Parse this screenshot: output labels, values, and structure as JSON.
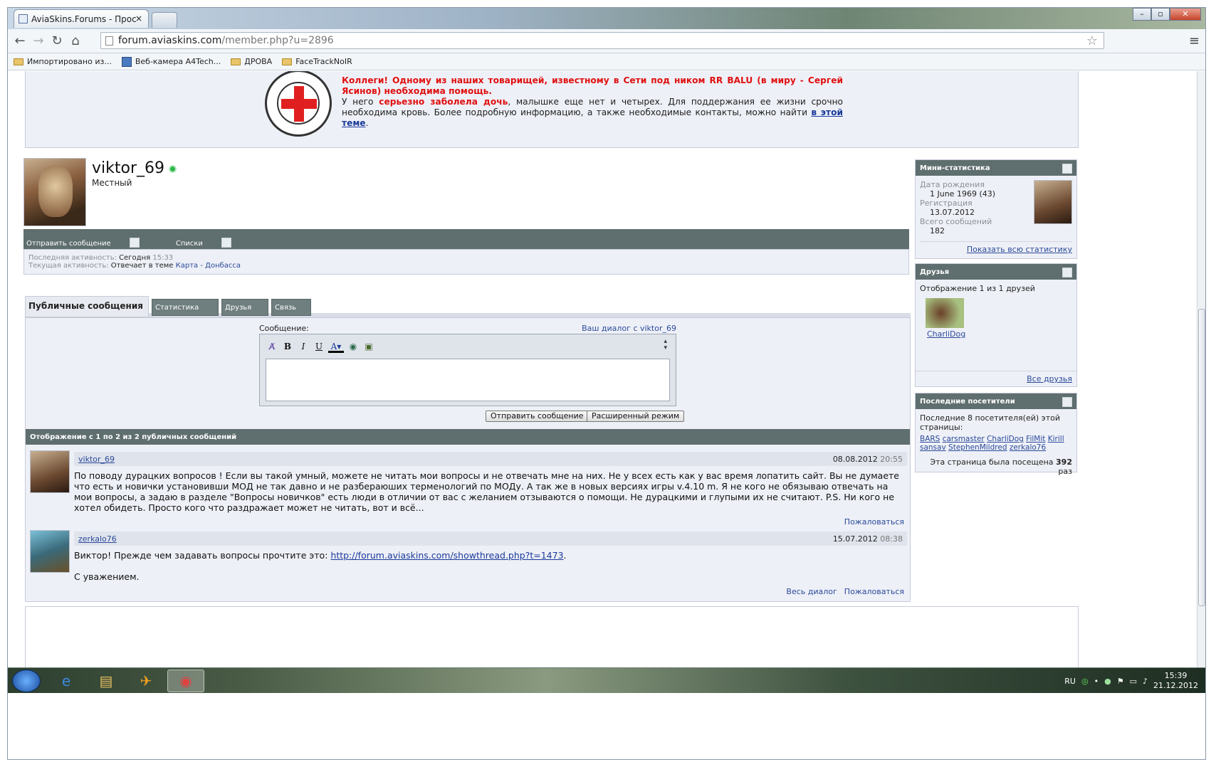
{
  "browser": {
    "tab_title": "AviaSkins.Forums - Прос",
    "tab_close": "×",
    "url_domain": "forum.aviaskins.com",
    "url_path": "/member.php?u=2896",
    "window_controls": {
      "minimize": "–",
      "maximize": "▫",
      "close": "✕"
    }
  },
  "bookmarks": [
    {
      "label": "Импортировано из...",
      "icon": "folder-icon"
    },
    {
      "label": "Веб-камера A4Tech...",
      "icon": "webcam-icon"
    },
    {
      "label": "ДРОВА",
      "icon": "folder-icon"
    },
    {
      "label": "FaceTrackNoIR",
      "icon": "folder-icon"
    }
  ],
  "notice": {
    "headline": "Коллеги! Одному из наших товарищей, известному в Сети под ником RR BALU (в миру - Сергей Ясинов) необходима помощь.",
    "line2_a": "У него ",
    "line2_red": "серьезно заболела дочь",
    "line2_b": ", малышке еще нет и четырех. Для поддержания ее жизни срочно необходима кровь. Более подробную информацию, а также необходимые контакты, можно найти ",
    "link": "в этой теме",
    "tail": "."
  },
  "profile": {
    "username": "viktor_69",
    "usertitle": "Местный",
    "actions": [
      "Отправить сообщение",
      "Списки"
    ],
    "last_activity_label": "Последняя активность:",
    "last_activity_day": "Сегодня",
    "last_activity_time": "15:33",
    "current_activity_label": "Текущая активность:",
    "current_activity_text": "Отвечает в теме",
    "current_activity_link": "Карта - Донбасса"
  },
  "tabs": [
    "Публичные сообщения",
    "Статистика",
    "Друзья",
    "Связь"
  ],
  "composer": {
    "label": "Сообщение:",
    "dialog_link": "Ваш диалог с viktor_69",
    "send_button": "Отправить сообщение",
    "advanced_button": "Расширенный режим"
  },
  "messages": {
    "header": "Отображение с 1 по 2 из 2 публичных сообщений",
    "posts": [
      {
        "author": "viktor_69",
        "date": "08.08.2012",
        "time": "20:55",
        "text": "По поводу дурацких вопросов ! Если вы такой умный, можете не читать мои вопросы и не отвечать мне на них. Не у всех есть как у вас время лопатить сайт. Вы не думаете что есть и новички установивши МОД не так давно и не разбераюших терменологий по МОДу. А так же в новых версиях игры v.4.10 m. Я не кого не обязываю отвечать на мои вопросы, а задаю в разделе \"Вопросы новичков\" есть люди в отличии от вас с желанием отзываются о помощи. Не дурацкими и глупыми их не считают. P.S. Ни кого не хотел обидеть. Просто кого что раздражает может не читать, вот и всё...",
        "report": "Пожаловаться"
      },
      {
        "author": "zerkalo76",
        "date": "15.07.2012",
        "time": "08:38",
        "text_a": "Виктор! Прежде чем задавать вопросы прочтите это: ",
        "link": "http://forum.aviaskins.com/showthread.php?t=1473",
        "text_b": ".",
        "sign": "С уважением.",
        "dialog": "Весь диалог",
        "report": "Пожаловаться"
      }
    ]
  },
  "sidebar": {
    "ministats": {
      "title": "Мини-статистика",
      "birth_label": "Дата рождения",
      "birth_value": "1 June 1969 (43)",
      "reg_label": "Регистрация",
      "reg_value": "13.07.2012",
      "posts_label": "Всего сообщений",
      "posts_value": "182",
      "more": "Показать всю статистику"
    },
    "friends": {
      "title": "Друзья",
      "count_text": "Отображение 1 из 1 друзей",
      "friend": "CharliDog",
      "all": "Все друзья"
    },
    "visitors": {
      "title": "Последние посетители",
      "intro": "Последние 8 посетителя(ей) этой страницы:",
      "names": [
        "BARS",
        "carsmaster",
        "CharliDog",
        "FilMit",
        "Kirill",
        "sansav",
        "StephenMildred",
        "zerkalo76"
      ],
      "views_text": "Эта страница была посещена",
      "views_count": "392",
      "views_unit": "раз"
    }
  },
  "taskbar": {
    "lang": "RU",
    "time": "15:39",
    "date": "21.12.2012"
  },
  "colors": {
    "accent_bar": "#5f6e6e",
    "panel_bg": "#eef0f7",
    "link": "#2a4a9a",
    "notice_red": "#e01010"
  }
}
